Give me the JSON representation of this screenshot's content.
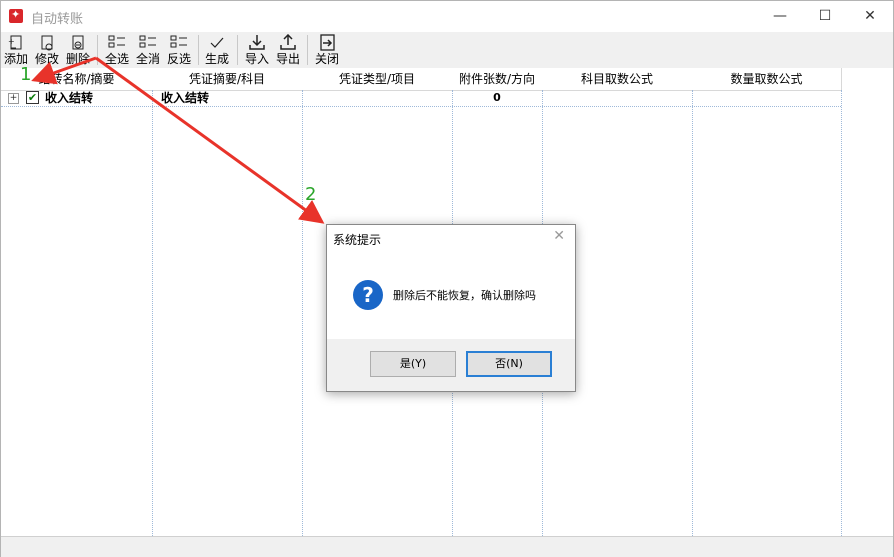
{
  "window": {
    "title": "自动转账",
    "minimize": "—",
    "maximize": "☐",
    "close": "✕"
  },
  "toolbar": {
    "add": "添加",
    "edit": "修改",
    "delete": "删除",
    "select_all": "全选",
    "deselect_all": "全消",
    "invert": "反选",
    "generate": "生成",
    "import": "导入",
    "export": "导出",
    "close": "关闭"
  },
  "grid": {
    "headers": [
      "结转名称/摘要",
      "凭证摘要/科目",
      "凭证类型/项目",
      "附件张数/方向",
      "科目取数公式",
      "数量取数公式"
    ],
    "rows": [
      {
        "name": "收入结转",
        "summary": "收入结转",
        "type": "",
        "attachments": "0",
        "checked": true
      }
    ]
  },
  "dialog": {
    "title": "系统提示",
    "message": "删除后不能恢复，确认删除吗",
    "yes": "是(Y)",
    "no": "否(N)"
  },
  "annotations": {
    "step1": "1",
    "step2": "2",
    "arrow_color": "#e8332a"
  }
}
